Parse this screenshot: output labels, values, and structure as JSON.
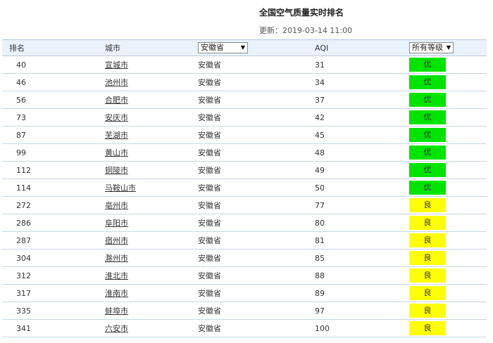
{
  "header": {
    "title": "全国空气质量实时排名",
    "update_text": "更新：2019-03-14 11:00"
  },
  "table": {
    "columns": {
      "rank": "排名",
      "city": "城市",
      "province_filter": "安徽省",
      "aqi": "AQI",
      "level_filter": "所有等级"
    },
    "rows": [
      {
        "rank": "40",
        "city": "宣城市",
        "province": "安徽省",
        "aqi": "31",
        "level": "优"
      },
      {
        "rank": "46",
        "city": "池州市",
        "province": "安徽省",
        "aqi": "34",
        "level": "优"
      },
      {
        "rank": "56",
        "city": "合肥市",
        "province": "安徽省",
        "aqi": "37",
        "level": "优"
      },
      {
        "rank": "73",
        "city": "安庆市",
        "province": "安徽省",
        "aqi": "42",
        "level": "优"
      },
      {
        "rank": "87",
        "city": "芜湖市",
        "province": "安徽省",
        "aqi": "45",
        "level": "优"
      },
      {
        "rank": "99",
        "city": "黄山市",
        "province": "安徽省",
        "aqi": "48",
        "level": "优"
      },
      {
        "rank": "112",
        "city": "铜陵市",
        "province": "安徽省",
        "aqi": "49",
        "level": "优"
      },
      {
        "rank": "114",
        "city": "马鞍山市",
        "province": "安徽省",
        "aqi": "50",
        "level": "优"
      },
      {
        "rank": "272",
        "city": "亳州市",
        "province": "安徽省",
        "aqi": "77",
        "level": "良"
      },
      {
        "rank": "286",
        "city": "阜阳市",
        "province": "安徽省",
        "aqi": "80",
        "level": "良"
      },
      {
        "rank": "287",
        "city": "宿州市",
        "province": "安徽省",
        "aqi": "81",
        "level": "良"
      },
      {
        "rank": "304",
        "city": "滁州市",
        "province": "安徽省",
        "aqi": "85",
        "level": "良"
      },
      {
        "rank": "312",
        "city": "淮北市",
        "province": "安徽省",
        "aqi": "88",
        "level": "良"
      },
      {
        "rank": "317",
        "city": "淮南市",
        "province": "安徽省",
        "aqi": "89",
        "level": "良"
      },
      {
        "rank": "335",
        "city": "蚌埠市",
        "province": "安徽省",
        "aqi": "97",
        "level": "良"
      },
      {
        "rank": "341",
        "city": "六安市",
        "province": "安徽省",
        "aqi": "100",
        "level": "良"
      }
    ]
  },
  "level_colors": {
    "优": "#00e400",
    "良": "#ffff00"
  },
  "icons": {
    "dropdown_arrow": "▼"
  }
}
